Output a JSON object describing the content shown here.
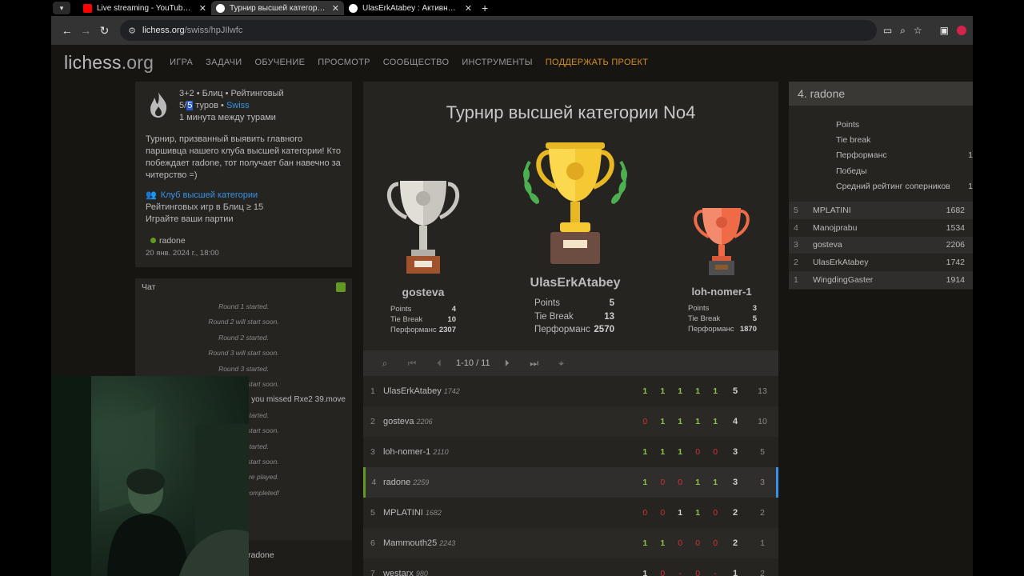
{
  "browser": {
    "tabs": [
      {
        "title": "Live streaming - YouTube Studio",
        "active": false,
        "favicon": "youtube-icon"
      },
      {
        "title": "Турнир высшей категории No4",
        "active": true,
        "favicon": "lichess-icon"
      },
      {
        "title": "UlasErkAtabey : Активность • lichess",
        "active": false,
        "favicon": "lichess-icon"
      }
    ],
    "url_host": "lichess.org",
    "url_path": "/swiss/hpJIlwfc"
  },
  "site": {
    "logo": "lichess",
    "logo_tld": ".org",
    "nav": [
      "ИГРА",
      "ЗАДАЧИ",
      "ОБУЧЕНИЕ",
      "ПРОСМОТР",
      "СООБЩЕСТВО",
      "ИНСТРУМЕНТЫ",
      "ПОДДЕРЖАТЬ ПРОЕКТ"
    ],
    "accent": "#d59020"
  },
  "info": {
    "setup_line": "3+2 • Блиц • Рейтинговый",
    "rounds_done": "5/",
    "rounds_total": "5",
    "rounds_word": " туров • ",
    "swiss_link": "Swiss",
    "interval": "1 минута между турами",
    "description": "Турнир, призванный выявить главного паршивца нашего клуба высшей категории! Кто побеждает radone, тот получает бан навечно за читерство =)",
    "club_link": "Клуб высшей категории",
    "condition": "Рейтинговых игр в Блиц ≥ 15",
    "play_prompt": "Играйте ваши партии",
    "creator": "radone",
    "created": "20 янв. 2024 г., 18:00"
  },
  "chat": {
    "title": "Чат",
    "lines": [
      "Round 1 started.",
      "Round 2 will start soon.",
      "Round 2 started.",
      "Round 3 will start soon.",
      "Round 3 started.",
      "Round 4 will start soon.",
      "xxxxxxxxxxxxxxx you missed Rxe2 39.move",
      "Round 4 started.",
      "Round 5 will start soon.",
      "Round 5 started.",
      "Round 6 will start soon.",
      "All games were played.",
      "Tournament completed!"
    ],
    "input_user": "radone"
  },
  "tournament": {
    "title": "Турнир высшей категории No4",
    "podium": [
      {
        "place": 2,
        "name": "gosteva",
        "stats": [
          [
            "Points",
            "4"
          ],
          [
            "Tie Break",
            "10"
          ],
          [
            "Перформанс",
            "2307"
          ]
        ]
      },
      {
        "place": 1,
        "name": "UlasErkAtabey",
        "stats": [
          [
            "Points",
            "5"
          ],
          [
            "Tie Break",
            "13"
          ],
          [
            "Перформанс",
            "2570"
          ]
        ]
      },
      {
        "place": 3,
        "name": "loh-nomer-1",
        "stats": [
          [
            "Points",
            "3"
          ],
          [
            "Tie Break",
            "5"
          ],
          [
            "Перформанс",
            "1870"
          ]
        ]
      }
    ],
    "pager": "1-10 / 11",
    "standings": [
      {
        "rank": "1",
        "name": "UlasErkAtabey",
        "rating": "1742",
        "rounds": [
          "1",
          "1",
          "1",
          "1",
          "1"
        ],
        "points": "5",
        "tb": "13"
      },
      {
        "rank": "2",
        "name": "gosteva",
        "rating": "2206",
        "rounds": [
          "0",
          "1",
          "1",
          "1",
          "1"
        ],
        "points": "4",
        "tb": "10"
      },
      {
        "rank": "3",
        "name": "loh-nomer-1",
        "rating": "2110",
        "rounds": [
          "1",
          "1",
          "1",
          "0",
          "0"
        ],
        "points": "3",
        "tb": "5"
      },
      {
        "rank": "4",
        "name": "radone",
        "rating": "2259",
        "rounds": [
          "1",
          "0",
          "0",
          "1",
          "1"
        ],
        "points": "3",
        "tb": "3",
        "me": true
      },
      {
        "rank": "5",
        "name": "MPLATINI",
        "rating": "1682",
        "rounds": [
          "0",
          "0",
          "1",
          "1",
          "0"
        ],
        "points": "2",
        "tb": "2"
      },
      {
        "rank": "6",
        "name": "Mammouth25",
        "rating": "2243",
        "rounds": [
          "1",
          "1",
          "0",
          "0",
          "0"
        ],
        "points": "2",
        "tb": "1"
      },
      {
        "rank": "7",
        "name": "westarx",
        "rating": "980",
        "rounds": [
          "1",
          "0",
          "-",
          "0",
          "-"
        ],
        "points": "1",
        "tb": "2"
      }
    ]
  },
  "player_panel": {
    "title": "4. radone",
    "stats": [
      [
        "Points",
        ""
      ],
      [
        "Tie break",
        ""
      ],
      [
        "Перформанс",
        "1"
      ],
      [
        "Победы",
        ""
      ],
      [
        "Средний рейтинг соперников",
        "1"
      ]
    ],
    "games": [
      {
        "round": "5",
        "opponent": "MPLATINI",
        "rating": "1682"
      },
      {
        "round": "4",
        "opponent": "Manojprabu",
        "rating": "1534"
      },
      {
        "round": "3",
        "opponent": "gosteva",
        "rating": "2206"
      },
      {
        "round": "2",
        "opponent": "UlasErkAtabey",
        "rating": "1742"
      },
      {
        "round": "1",
        "opponent": "WingdingGaster",
        "rating": "1914"
      }
    ]
  },
  "colors": {
    "win": "#8bc34a",
    "loss": "#cc3333",
    "link": "#3692e7",
    "online": "#629924"
  }
}
